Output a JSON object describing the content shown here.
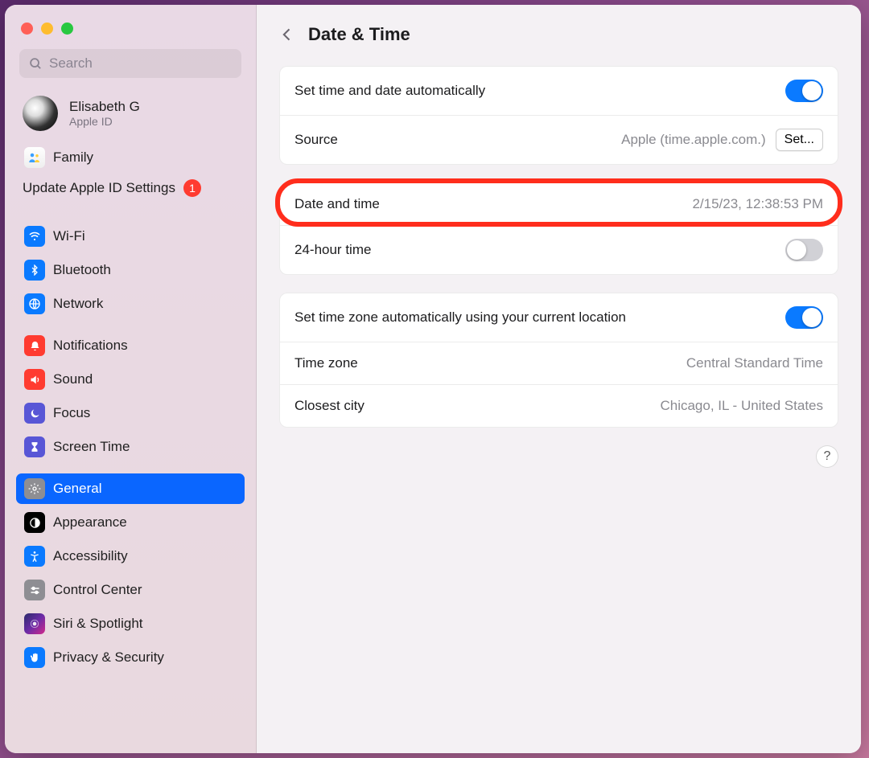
{
  "sidebar": {
    "search_placeholder": "Search",
    "user": {
      "name": "Elisabeth G",
      "sub": "Apple ID"
    },
    "family_label": "Family",
    "update_label": "Update Apple ID Settings",
    "update_badge": "1",
    "items": {
      "wifi": "Wi-Fi",
      "bluetooth": "Bluetooth",
      "network": "Network",
      "notifications": "Notifications",
      "sound": "Sound",
      "focus": "Focus",
      "screen_time": "Screen Time",
      "general": "General",
      "appearance": "Appearance",
      "accessibility": "Accessibility",
      "control_center": "Control Center",
      "siri": "Siri & Spotlight",
      "privacy": "Privacy & Security"
    }
  },
  "header": {
    "title": "Date & Time"
  },
  "panel1": {
    "auto_label": "Set time and date automatically",
    "auto_on": true,
    "source_label": "Source",
    "source_value": "Apple (time.apple.com.)",
    "set_button": "Set..."
  },
  "panel2": {
    "dt_label": "Date and time",
    "dt_value": "2/15/23, 12:38:53 PM",
    "h24_label": "24-hour time",
    "h24_on": false
  },
  "panel3": {
    "auto_tz_label": "Set time zone automatically using your current location",
    "auto_tz_on": true,
    "tz_label": "Time zone",
    "tz_value": "Central Standard Time",
    "city_label": "Closest city",
    "city_value": "Chicago, IL - United States"
  },
  "help": "?"
}
